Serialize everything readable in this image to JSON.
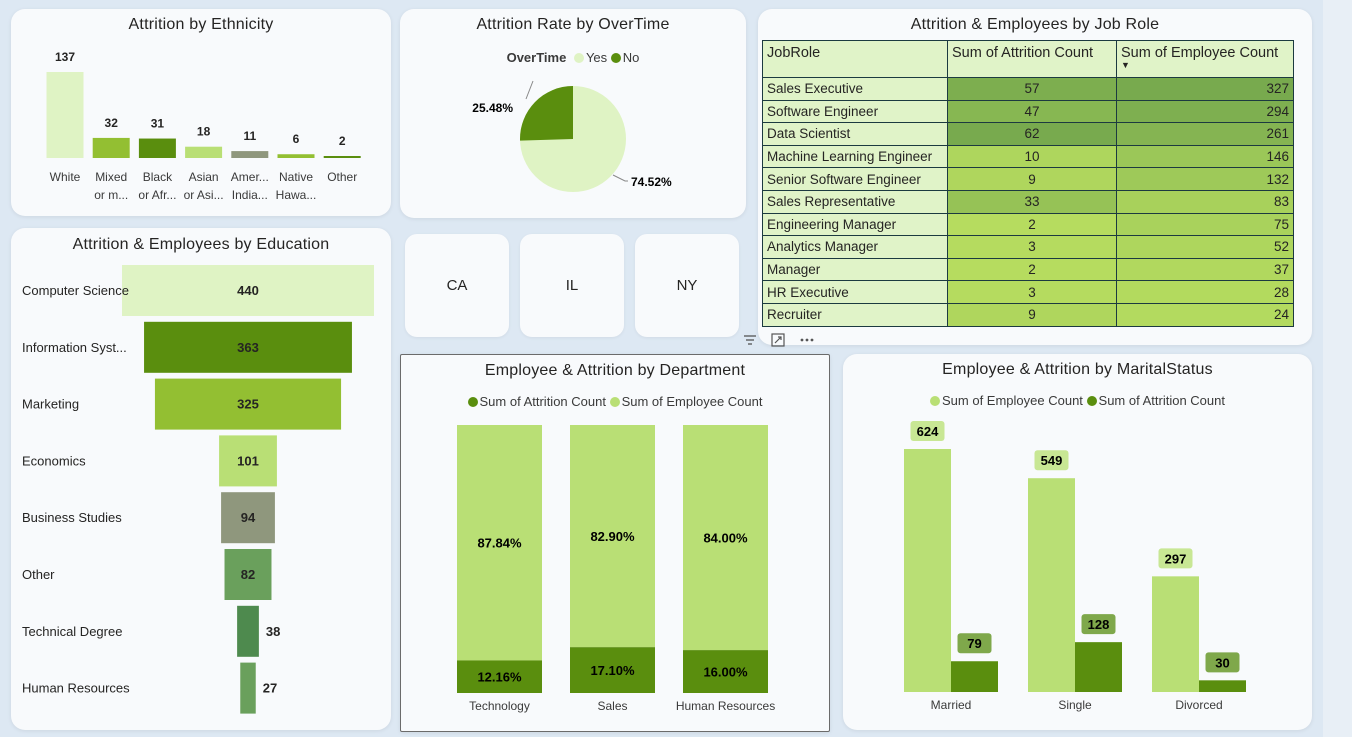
{
  "colors": {
    "light": "#dff3c4",
    "mid": "#b9df75",
    "green": "#93bf32",
    "dark": "#5a8e0e",
    "olive": "#8f977d",
    "sage": "#6aa05c",
    "teal": "#4e8a4e",
    "navy": "#1c3a40"
  },
  "ethnicity": {
    "title": "Attrition by Ethnicity",
    "chart_data": {
      "type": "bar",
      "categories": [
        [
          "White",
          ""
        ],
        [
          "Mixed",
          "or m..."
        ],
        [
          "Black",
          "or Afr..."
        ],
        [
          "Asian",
          "or Asi..."
        ],
        [
          "Amer...",
          "India..."
        ],
        [
          "Native",
          "Hawa..."
        ],
        [
          "Other",
          ""
        ]
      ],
      "values": [
        137,
        32,
        31,
        18,
        11,
        6,
        2
      ],
      "colors": [
        "#dff3c4",
        "#93bf32",
        "#5a8e0e",
        "#b9df75",
        "#8f977d",
        "#93bf32",
        "#5a8e0e"
      ]
    }
  },
  "overtime": {
    "title": "Attrition Rate by OverTime",
    "legend_title": "OverTime",
    "chart_data": {
      "type": "pie",
      "series": [
        {
          "name": "Yes",
          "value": 74.52,
          "label": "74.52%",
          "color": "#dff3c4"
        },
        {
          "name": "No",
          "value": 25.48,
          "label": "25.48%",
          "color": "#5a8e0e"
        }
      ]
    }
  },
  "jobrole": {
    "title": "Attrition & Employees by Job Role",
    "headers": [
      "JobRole",
      "Sum of Attrition Count",
      "Sum of Employee Count"
    ],
    "sort_indicator": "▼",
    "chart_data": {
      "type": "table",
      "rows": [
        [
          "Sales Executive",
          57,
          327
        ],
        [
          "Software Engineer",
          47,
          294
        ],
        [
          "Data Scientist",
          62,
          261
        ],
        [
          "Machine Learning Engineer",
          10,
          146
        ],
        [
          "Senior Software Engineer",
          9,
          132
        ],
        [
          "Sales Representative",
          33,
          83
        ],
        [
          "Engineering Manager",
          2,
          75
        ],
        [
          "Analytics Manager",
          3,
          52
        ],
        [
          "Manager",
          2,
          37
        ],
        [
          "HR Executive",
          3,
          28
        ],
        [
          "Recruiter",
          9,
          24
        ]
      ]
    }
  },
  "states": [
    "CA",
    "IL",
    "NY"
  ],
  "toolbar": {
    "filter_icon": "filter-icon",
    "focus_icon": "focus-mode-icon",
    "more_icon": "more-options-icon"
  },
  "education": {
    "title": "Attrition & Employees by Education",
    "chart_data": {
      "type": "bar",
      "categories": [
        "Computer Science",
        "Information Syst...",
        "Marketing",
        "Economics",
        "Business Studies",
        "Other",
        "Technical Degree",
        "Human Resources"
      ],
      "values": [
        440,
        363,
        325,
        101,
        94,
        82,
        38,
        27
      ],
      "colors": [
        "#dff3c4",
        "#5a8e0e",
        "#93bf32",
        "#b9df75",
        "#8f977d",
        "#6aa05c",
        "#4e8a4e",
        "#6aa05c"
      ]
    }
  },
  "department": {
    "title": "Employee & Attrition by Department",
    "legend": [
      {
        "name": "Sum of Attrition Count",
        "color": "#5a8e0e"
      },
      {
        "name": "Sum of Employee Count",
        "color": "#b9df75"
      }
    ],
    "chart_data": {
      "type": "bar",
      "stacked": "100%",
      "categories": [
        "Technology",
        "Sales",
        "Human Resources"
      ],
      "series": [
        {
          "name": "Sum of Attrition Count",
          "values": [
            12.16,
            17.1,
            16.0
          ],
          "labels": [
            "12.16%",
            "17.10%",
            "16.00%"
          ]
        },
        {
          "name": "Sum of Employee Count",
          "values": [
            87.84,
            82.9,
            84.0
          ],
          "labels": [
            "87.84%",
            "82.90%",
            "84.00%"
          ]
        }
      ]
    }
  },
  "marital": {
    "title": "Employee & Attrition by MaritalStatus",
    "legend": [
      {
        "name": "Sum of Employee Count",
        "color": "#b9df75"
      },
      {
        "name": "Sum of Attrition Count",
        "color": "#5a8e0e"
      }
    ],
    "chart_data": {
      "type": "bar",
      "categories": [
        "Married",
        "Single",
        "Divorced"
      ],
      "series": [
        {
          "name": "Sum of Employee Count",
          "values": [
            624,
            549,
            297
          ]
        },
        {
          "name": "Sum of Attrition Count",
          "values": [
            79,
            128,
            30
          ]
        }
      ],
      "ylim": [
        0,
        624
      ]
    }
  }
}
